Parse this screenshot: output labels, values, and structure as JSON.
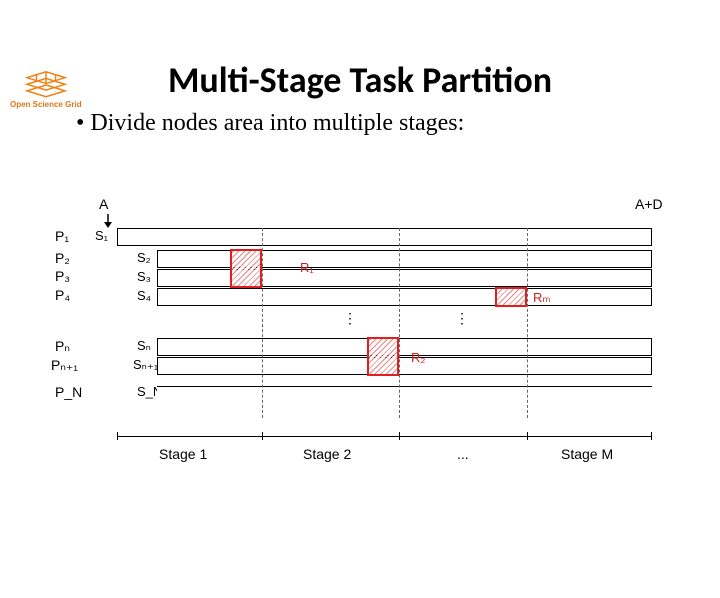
{
  "logo": {
    "text": "Open Science Grid",
    "icon": "osg-grid-icon"
  },
  "title": "Multi-Stage Task Partition",
  "bullet_text": "Divide nodes area into multiple stages:",
  "diagram": {
    "top_labels": {
      "left": "A",
      "right": "A+D"
    },
    "row_labels": [
      "P₁",
      "P₂",
      "P₃",
      "P₄",
      "Pₙ",
      "Pₙ₊₁",
      "P_N"
    ],
    "s_labels": [
      "S₁",
      "S₂",
      "S₃",
      "S₄",
      "Sₙ",
      "Sₙ₊₁",
      "S_N"
    ],
    "r_labels": [
      "R₁",
      "R₂",
      "Rₘ"
    ],
    "stage_labels": [
      "Stage 1",
      "Stage 2",
      "...",
      "Stage M"
    ],
    "ellipsis": "⋮"
  },
  "chart_data": {
    "type": "schematic-timeline",
    "description": "Gantt-like schematic of N processes P1..PN, each with a segment S1..SN. Red hatched rectangles R1..Rm mark partition boundaries. X-axis divided into Stage 1..Stage M spanning time range [A, A+D].",
    "x_range": [
      "A",
      "A+D"
    ],
    "stages": [
      "Stage 1",
      "Stage 2",
      "...",
      "Stage M"
    ],
    "rows": [
      {
        "id": "P1",
        "segment": "S1",
        "block": 1
      },
      {
        "id": "P2",
        "segment": "S2",
        "block": 1
      },
      {
        "id": "P3",
        "segment": "S3",
        "block": 1
      },
      {
        "id": "P4",
        "segment": "S4",
        "block": 1
      },
      {
        "id": "Pn",
        "segment": "Sn",
        "block": 2
      },
      {
        "id": "Pn+1",
        "segment": "Sn+1",
        "block": 2
      },
      {
        "id": "PN",
        "segment": "SN",
        "block": 2
      }
    ],
    "markers": [
      {
        "id": "R1",
        "row": "P2-P3",
        "stage_between": [
          1,
          2
        ]
      },
      {
        "id": "R2",
        "row": "Pn-Pn+1",
        "stage_between": [
          2,
          3
        ]
      },
      {
        "id": "Rm",
        "row": "P4",
        "stage_between": [
          "M-1",
          "M"
        ]
      }
    ]
  }
}
